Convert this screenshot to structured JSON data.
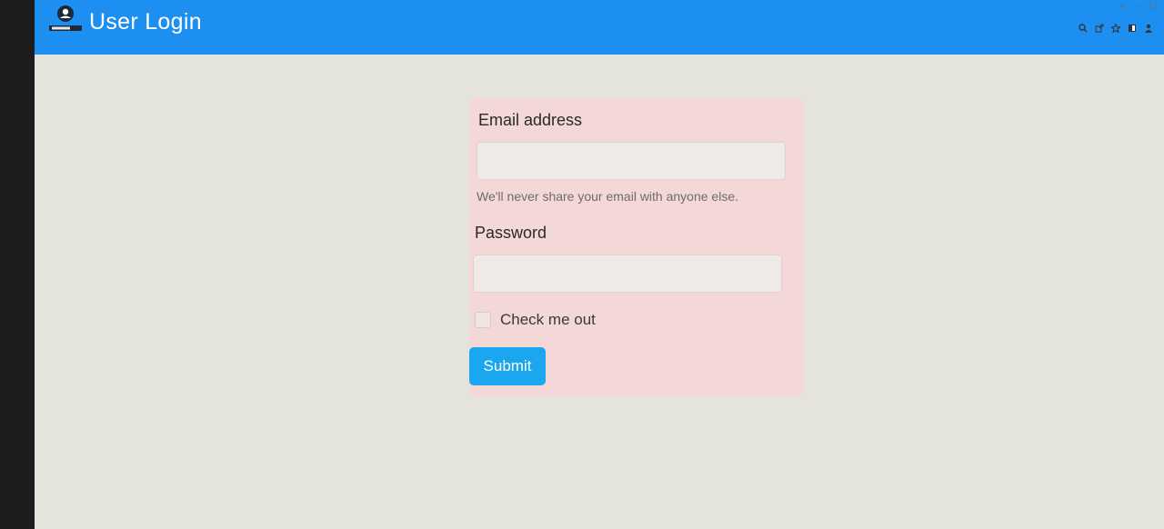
{
  "header": {
    "title": "User Login",
    "logo_icon": "user-login-logo-icon",
    "bg_color": "#1d8ff0"
  },
  "browser": {
    "window_controls": [
      "˅",
      "–",
      "☐"
    ],
    "toolbar_icons": [
      "zoom-icon",
      "share-icon",
      "star-icon",
      "sidepanel-icon",
      "profile-icon"
    ]
  },
  "form": {
    "email_label": "Email address",
    "email_value": "",
    "email_help": "We'll never share your email with anyone else.",
    "password_label": "Password",
    "password_value": "",
    "checkbox_label": "Check me out",
    "checkbox_checked": false,
    "submit_label": "Submit",
    "submit_color": "#1aa7ef"
  }
}
